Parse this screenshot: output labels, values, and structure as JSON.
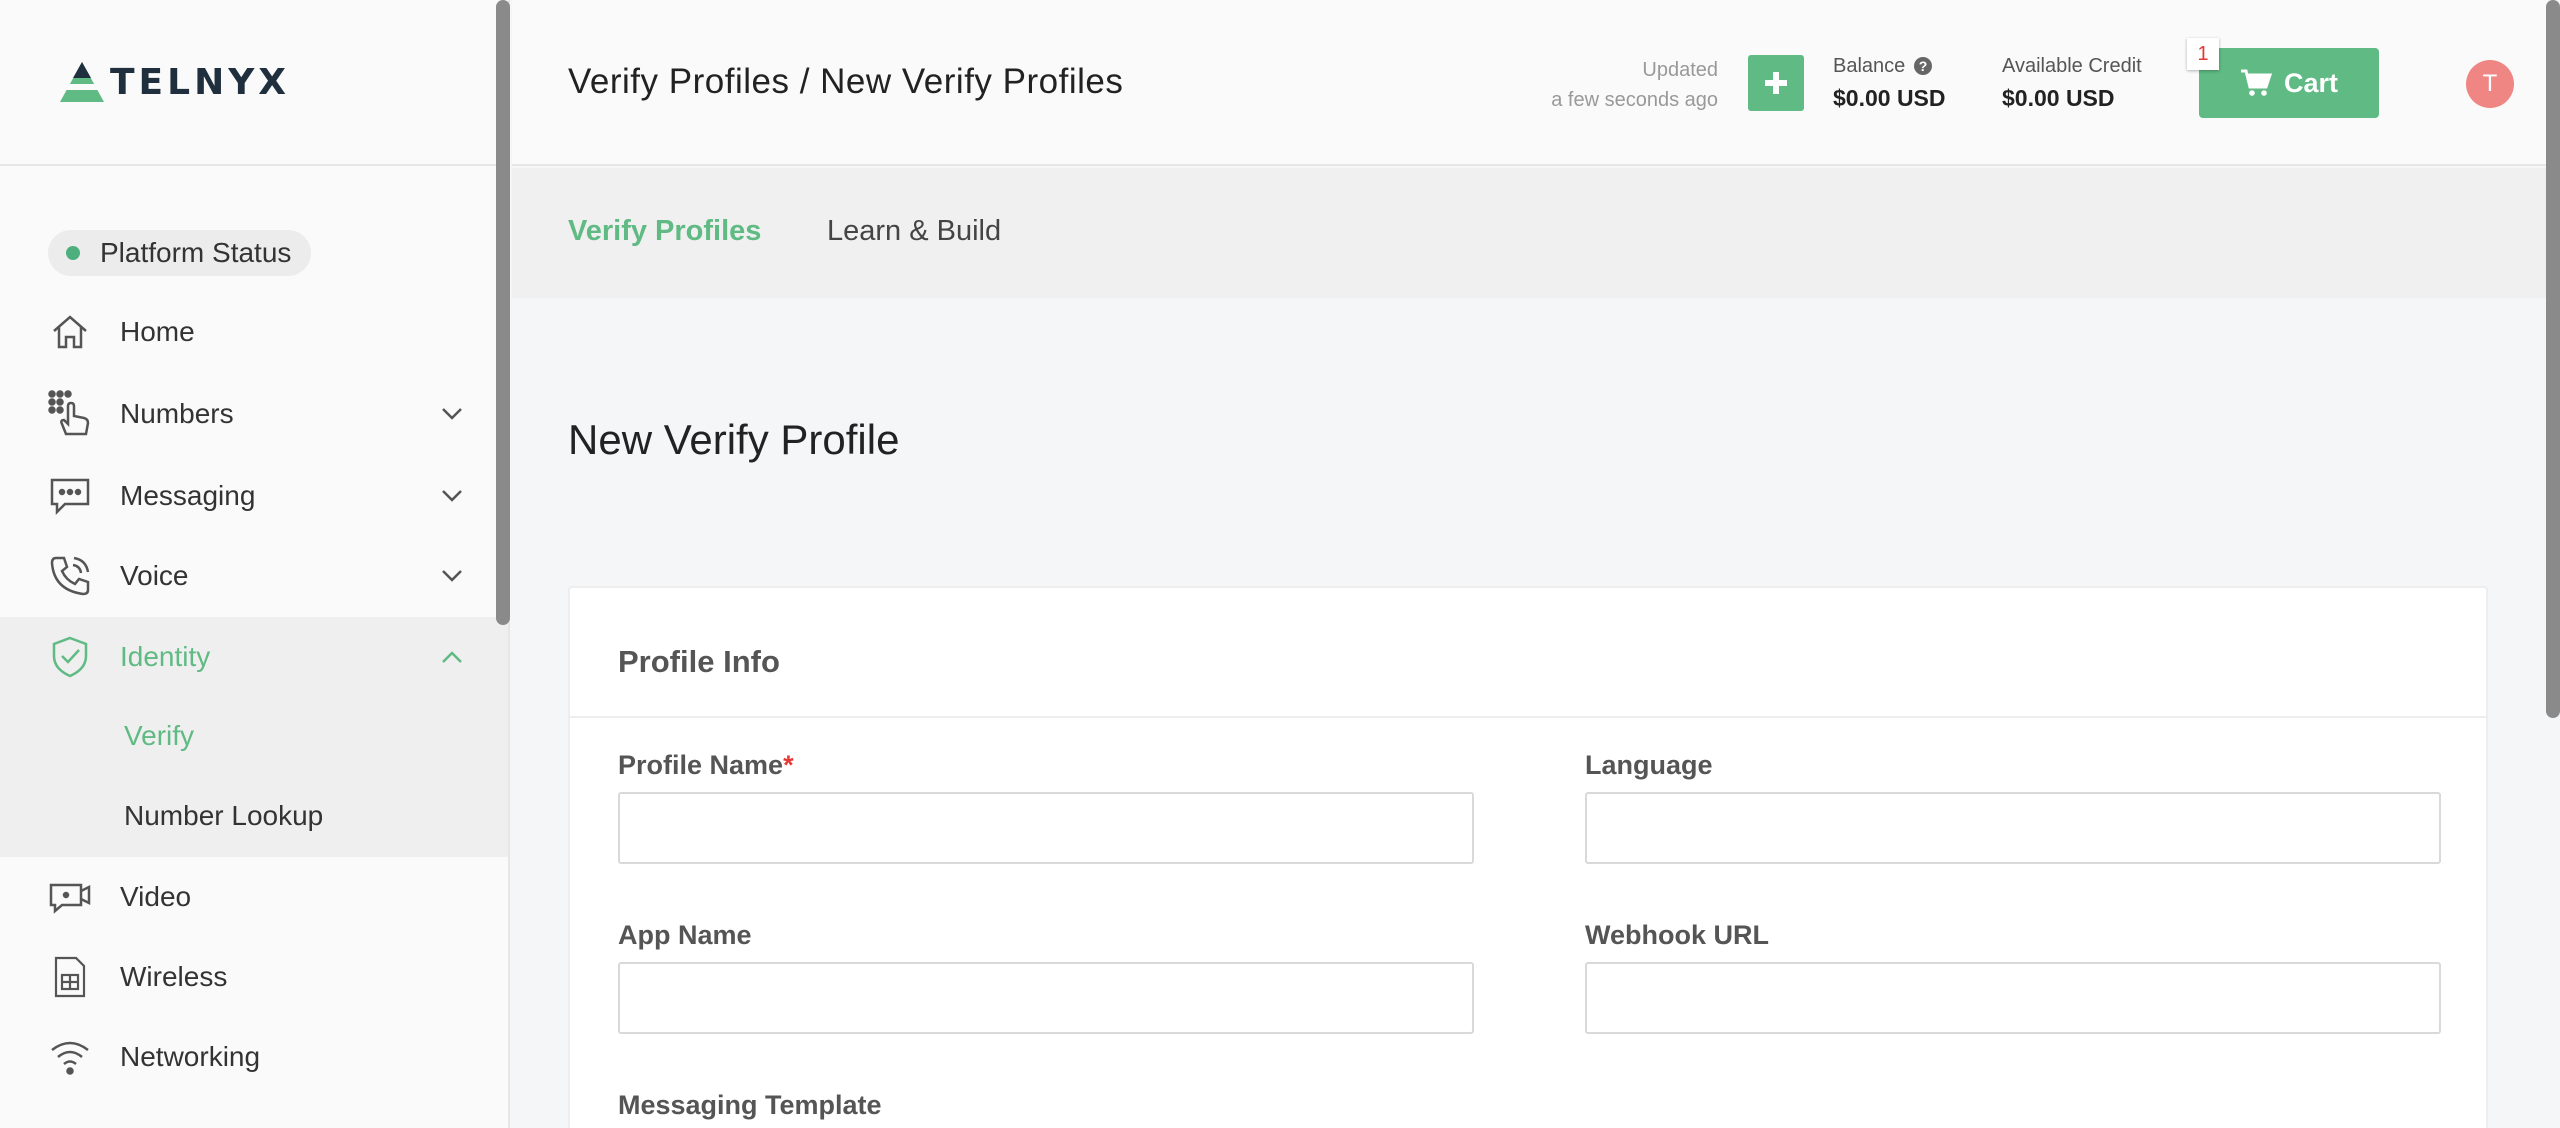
{
  "brand": {
    "name": "TELNYX",
    "accent": "#5fba83"
  },
  "sidebar": {
    "platform_status": "Platform Status",
    "items": [
      {
        "label": "Home",
        "icon": "home-icon"
      },
      {
        "label": "Numbers",
        "icon": "numbers-icon"
      },
      {
        "label": "Messaging",
        "icon": "messaging-icon"
      },
      {
        "label": "Voice",
        "icon": "voice-icon"
      },
      {
        "label": "Identity",
        "icon": "shield-check-icon"
      },
      {
        "label": "Video",
        "icon": "video-icon"
      },
      {
        "label": "Wireless",
        "icon": "sim-card-icon"
      },
      {
        "label": "Networking",
        "icon": "wifi-icon"
      }
    ],
    "identity_sub": [
      {
        "label": "Verify"
      },
      {
        "label": "Number Lookup"
      }
    ]
  },
  "header": {
    "breadcrumb": "Verify Profiles / New Verify Profiles",
    "updated_label": "Updated",
    "updated_time": "a few seconds ago",
    "balance_label": "Balance",
    "balance_value": "$0.00 USD",
    "credit_label": "Available Credit",
    "credit_value": "$0.00 USD",
    "cart_label": "Cart",
    "cart_count": "1",
    "avatar_initial": "T"
  },
  "tabs": [
    {
      "label": "Verify Profiles"
    },
    {
      "label": "Learn & Build"
    }
  ],
  "main": {
    "title": "New Verify Profile",
    "card_title": "Profile Info",
    "fields": {
      "profile_name": {
        "label": "Profile Name",
        "required": "*",
        "value": ""
      },
      "language": {
        "label": "Language",
        "value": ""
      },
      "app_name": {
        "label": "App Name",
        "value": ""
      },
      "webhook_url": {
        "label": "Webhook URL",
        "value": ""
      },
      "messaging_template": {
        "label": "Messaging Template"
      }
    }
  }
}
